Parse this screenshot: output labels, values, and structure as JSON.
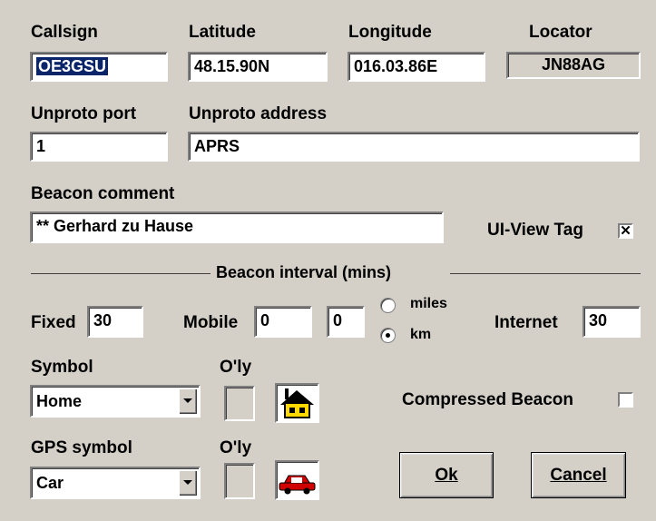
{
  "station": {
    "callsign_label": "Callsign",
    "callsign_value": "OE3GSU",
    "latitude_label": "Latitude",
    "latitude_value": "48.15.90N",
    "longitude_label": "Longitude",
    "longitude_value": "016.03.86E",
    "locator_label": "Locator",
    "locator_value": "JN88AG"
  },
  "unproto": {
    "port_label": "Unproto port",
    "port_value": "1",
    "address_label": "Unproto address",
    "address_value": "APRS"
  },
  "beacon": {
    "comment_label": "Beacon comment",
    "comment_value": "** Gerhard zu Hause",
    "uiview_tag_label": "UI-View Tag",
    "uiview_tag_checked": true
  },
  "interval": {
    "title": "Beacon interval (mins)",
    "fixed_label": "Fixed",
    "fixed_value": "30",
    "mobile_label": "Mobile",
    "mobile_value1": "0",
    "mobile_value2": "0",
    "unit_miles_label": "miles",
    "unit_km_label": "km",
    "selected_unit": "km",
    "internet_label": "Internet",
    "internet_value": "30"
  },
  "symbol": {
    "symbol_label": "Symbol",
    "symbol_value": "Home",
    "overlay_label": "O'ly",
    "compressed_label": "Compressed Beacon",
    "compressed_checked": false,
    "gps_symbol_label": "GPS symbol",
    "gps_symbol_value": "Car",
    "gps_overlay_label": "O'ly"
  },
  "buttons": {
    "ok_label": "Ok",
    "cancel_label": "Cancel"
  },
  "icons": {
    "home_symbol": "house-icon",
    "gps_symbol": "car-icon"
  }
}
